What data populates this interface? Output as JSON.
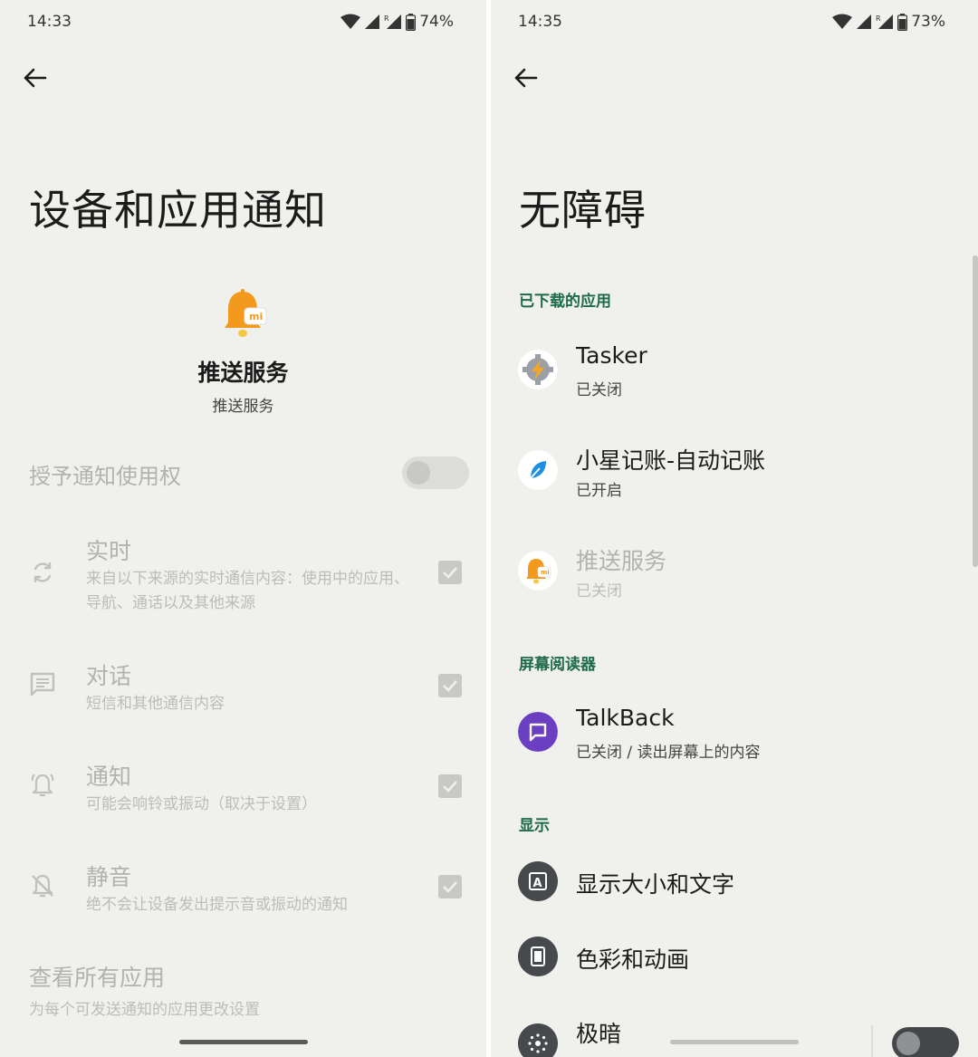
{
  "left": {
    "status": {
      "time": "14:33",
      "battery": "74%"
    },
    "title": "设备和应用通知",
    "app": {
      "name": "推送服务",
      "subtitle": "推送服务",
      "icon": "mi-push-bell-icon"
    },
    "grant": {
      "label": "授予通知使用权",
      "enabled": false
    },
    "options": [
      {
        "title": "实时",
        "desc": "来自以下来源的实时通信内容：使用中的应用、导航、通话以及其他来源",
        "icon": "sync-icon",
        "checked": true
      },
      {
        "title": "对话",
        "desc": "短信和其他通信内容",
        "icon": "chat-icon",
        "checked": true
      },
      {
        "title": "通知",
        "desc": "可能会响铃或振动（取决于设置）",
        "icon": "alert-bell-icon",
        "checked": true
      },
      {
        "title": "静音",
        "desc": "绝不会让设备发出提示音或振动的通知",
        "icon": "silent-bell-icon",
        "checked": true
      }
    ],
    "all_apps": {
      "title": "查看所有应用",
      "desc": "为每个可发送通知的应用更改设置"
    }
  },
  "right": {
    "status": {
      "time": "14:35",
      "battery": "73%"
    },
    "title": "无障碍",
    "sections": {
      "downloaded": "已下载的应用",
      "screen_reader": "屏幕阅读器",
      "display": "显示"
    },
    "apps": [
      {
        "name": "Tasker",
        "status": "已关闭",
        "icon": "tasker-icon"
      },
      {
        "name": "小星记账-自动记账",
        "status": "已开启",
        "icon": "leaf-icon"
      },
      {
        "name": "推送服务",
        "status": "已关闭",
        "icon": "mi-push-bell-icon"
      }
    ],
    "talkback": {
      "name": "TalkBack",
      "status": "已关闭 / 读出屏幕上的内容",
      "icon": "talkback-icon"
    },
    "display_items": [
      {
        "name": "显示大小和文字",
        "icon": "text-size-icon"
      },
      {
        "name": "色彩和动画",
        "icon": "color-motion-icon"
      },
      {
        "name": "极暗",
        "icon": "extra-dim-icon",
        "enabled": false
      }
    ]
  },
  "colors": {
    "accent": "#1d6b48",
    "background": "#f0f0ec",
    "talkback": "#6a3fc1"
  }
}
